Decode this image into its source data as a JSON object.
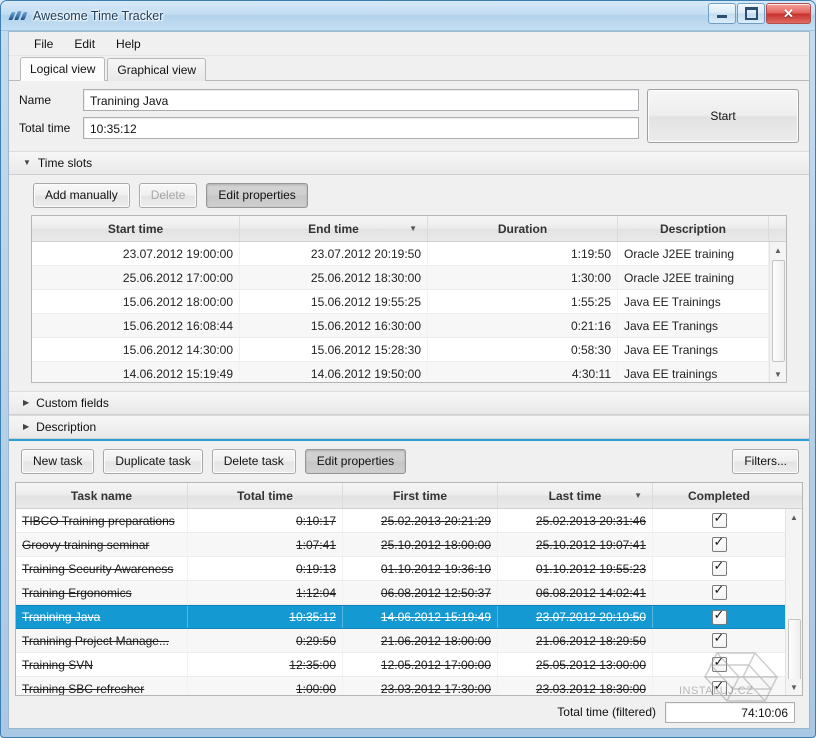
{
  "window": {
    "title": "Awesome Time Tracker",
    "icon": "app-icon",
    "buttons": {
      "minimize": "–",
      "maximize": "□",
      "close": "✕"
    }
  },
  "menu": {
    "items": [
      "File",
      "Edit",
      "Help"
    ]
  },
  "tabs": [
    {
      "label": "Logical view",
      "active": true
    },
    {
      "label": "Graphical view",
      "active": false
    }
  ],
  "form": {
    "name_label": "Name",
    "name_value": "Tranining Java",
    "total_time_label": "Total time",
    "total_time_value": "10:35:12",
    "start_button": "Start"
  },
  "sections": {
    "time_slots": {
      "label": "Time slots",
      "expanded": true,
      "arrow": "▼"
    },
    "custom_fields": {
      "label": "Custom fields",
      "expanded": false,
      "arrow": "▶"
    },
    "description": {
      "label": "Description",
      "expanded": false,
      "arrow": "▶"
    }
  },
  "slot_buttons": {
    "add_manually": "Add manually",
    "delete": "Delete",
    "edit_properties": "Edit properties"
  },
  "slots_table": {
    "columns": [
      "Start time",
      "End time",
      "Duration",
      "Description"
    ],
    "sorted_column": "End time",
    "sort_arrow": "▼",
    "rows": [
      {
        "start": "23.07.2012 19:00:00",
        "end": "23.07.2012 20:19:50",
        "duration": "1:19:50",
        "description": "Oracle J2EE training"
      },
      {
        "start": "25.06.2012 17:00:00",
        "end": "25.06.2012 18:30:00",
        "duration": "1:30:00",
        "description": "Oracle J2EE training"
      },
      {
        "start": "15.06.2012 18:00:00",
        "end": "15.06.2012 19:55:25",
        "duration": "1:55:25",
        "description": "Java EE Trainings"
      },
      {
        "start": "15.06.2012 16:08:44",
        "end": "15.06.2012 16:30:00",
        "duration": "0:21:16",
        "description": "Java EE Tranings"
      },
      {
        "start": "15.06.2012 14:30:00",
        "end": "15.06.2012 15:28:30",
        "duration": "0:58:30",
        "description": "Java EE Tranings"
      },
      {
        "start": "14.06.2012 15:19:49",
        "end": "14.06.2012 19:50:00",
        "duration": "4:30:11",
        "description": "Java EE trainings"
      }
    ]
  },
  "task_buttons": {
    "new_task": "New task",
    "duplicate_task": "Duplicate task",
    "delete_task": "Delete task",
    "edit_properties": "Edit properties",
    "filters": "Filters..."
  },
  "tasks_table": {
    "columns": [
      "Task name",
      "Total time",
      "First time",
      "Last time",
      "Completed"
    ],
    "sorted_column": "Last time",
    "sort_arrow": "▼",
    "check_glyph": "✓",
    "rows": [
      {
        "name": "TIBCO Training preparations",
        "total": "0:10:17",
        "first": "25.02.2013 20:21:29",
        "last": "25.02.2013 20:31:46",
        "completed": true,
        "selected": false
      },
      {
        "name": "Groovy training seminar",
        "total": "1:07:41",
        "first": "25.10.2012 18:00:00",
        "last": "25.10.2012 19:07:41",
        "completed": true,
        "selected": false
      },
      {
        "name": "Training Security Awareness",
        "total": "0:19:13",
        "first": "01.10.2012 19:36:10",
        "last": "01.10.2012 19:55:23",
        "completed": true,
        "selected": false
      },
      {
        "name": "Training Ergonomics",
        "total": "1:12:04",
        "first": "06.08.2012 12:50:37",
        "last": "06.08.2012 14:02:41",
        "completed": true,
        "selected": false
      },
      {
        "name": "Tranining Java",
        "total": "10:35:12",
        "first": "14.06.2012 15:19:49",
        "last": "23.07.2012 20:19:50",
        "completed": true,
        "selected": true
      },
      {
        "name": "Tranining Project Manage...",
        "total": "0:29:50",
        "first": "21.06.2012 18:00:00",
        "last": "21.06.2012 18:29:50",
        "completed": true,
        "selected": false
      },
      {
        "name": "Training SVN",
        "total": "12:35:00",
        "first": "12.05.2012 17:00:00",
        "last": "25.05.2012 13:00:00",
        "completed": true,
        "selected": false
      },
      {
        "name": "Training SBC refresher",
        "total": "1:00:00",
        "first": "23.03.2012 17:30:00",
        "last": "23.03.2012 18:30:00",
        "completed": true,
        "selected": false
      }
    ]
  },
  "status": {
    "label": "Total time (filtered)",
    "value": "74:10:06"
  },
  "watermark": {
    "text": "INSTALUJ.CZ"
  },
  "colors": {
    "accent": "#1499d3",
    "titlebar": "#c3ddf2",
    "window_border": "#3c7fb1",
    "close_button": "#c7302c"
  }
}
